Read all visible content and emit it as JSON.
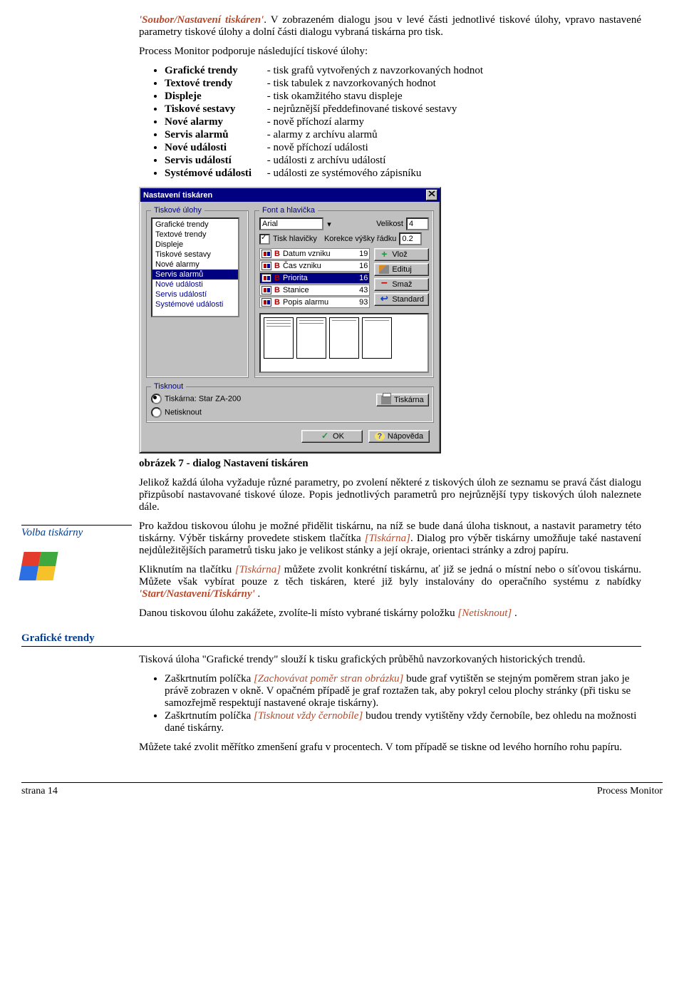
{
  "intro": {
    "menu_path": "'Soubor/Nastavení tiskáren'",
    "sentence_rest": ". V zobrazeném dialogu jsou v levé části jednotlivé tiskové úlohy, vpravo nastavené parametry tiskové úlohy a dolní části dialogu vybraná tiskárna pro tisk.",
    "lead": "Process Monitor podporuje následující tiskové úlohy:"
  },
  "jobs": [
    {
      "term": "Grafické trendy",
      "desc": "- tisk grafů vytvořených z navzorkovaných hodnot"
    },
    {
      "term": "Textové trendy",
      "desc": "- tisk tabulek z navzorkovaných hodnot"
    },
    {
      "term": "Displeje",
      "desc": "- tisk okamžitého stavu displeje"
    },
    {
      "term": "Tiskové sestavy",
      "desc": "- nejrůznější předdefinované tiskové sestavy"
    },
    {
      "term": "Nové alarmy",
      "desc": "- nově příchozí alarmy"
    },
    {
      "term": "Servis alarmů",
      "desc": "- alarmy z archívu alarmů"
    },
    {
      "term": "Nové události",
      "desc": "- nově příchozí události"
    },
    {
      "term": "Servis událostí",
      "desc": "- události z archívu událostí"
    },
    {
      "term": "Systémové události",
      "desc": "- události ze systémového zápisníku"
    }
  ],
  "dialog": {
    "title": "Nastavení tiskáren",
    "group_jobs": "Tiskové úlohy",
    "group_font": "Font a hlavička",
    "jobs_list": [
      {
        "t": "Grafické trendy"
      },
      {
        "t": "Textové trendy"
      },
      {
        "t": "Displeje"
      },
      {
        "t": "Tiskové sestavy"
      },
      {
        "t": "Nové alarmy"
      },
      {
        "t": "Servis alarmů",
        "sel": true
      },
      {
        "t": "Nové události",
        "blue": true
      },
      {
        "t": "Servis událostí",
        "blue": true
      },
      {
        "t": "Systémové události",
        "blue": true
      }
    ],
    "font_value": "Arial",
    "size_label": "Velikost",
    "size_value": "4",
    "head_check": "Tisk hlavičky",
    "corr_label": "Korekce výšky řádku",
    "corr_value": "0.2",
    "columns": [
      {
        "letter": "B",
        "name": "Datum vzniku",
        "val": "19"
      },
      {
        "letter": "B",
        "name": "Čas vzniku",
        "val": "16"
      },
      {
        "letter": "B",
        "name": "Priorita",
        "val": "16",
        "sel": true
      },
      {
        "letter": "B",
        "name": "Stanice",
        "val": "43"
      },
      {
        "letter": "B",
        "name": "Popis alarmu",
        "val": "93"
      }
    ],
    "btn_insert": "Vlož",
    "btn_edit": "Edituj",
    "btn_delete": "Smaž",
    "btn_standard": "Standard",
    "group_print": "Tisknout",
    "radio_printer": "Tiskárna: Star ZA-200",
    "radio_noprint": "Netisknout",
    "btn_printer": "Tiskárna",
    "btn_ok": "OK",
    "btn_help": "Nápověda"
  },
  "fig_caption": "obrázek 7 - dialog Nastavení tiskáren",
  "after_fig": "Jelikož každá úloha vyžaduje různé parametry, po zvolení některé z tiskových úloh ze seznamu se pravá část dialogu přizpůsobí nastavované tiskové úloze. Popis jednotlivých parametrů pro nejrůznější typy tiskových úloh naleznete dále.",
  "volba": {
    "label": "Volba tiskárny",
    "p1_a": "Pro každou tiskovou úlohu je možné přidělit tiskárnu, na níž se bude daná úloha tisknout, a nastavit parametry této tiskárny. Výběr tiskárny provedete stiskem tlačítka ",
    "p1_btn": "[Tiskárna]",
    "p1_b": ". Dialog pro výběr tiskárny umožňuje také nastavení nejdůležitějších parametrů tisku jako je velikost stánky a její okraje, orientaci stránky a zdroj papíru.",
    "p2_a": "Kliknutím na tlačítku ",
    "p2_btn": "[Tiskárna]",
    "p2_b": " můžete zvolit konkrétní tiskárnu, ať již se jedná o místní nebo o síťovou tiskárnu. Můžete však vybírat pouze z těch tiskáren, které již byly instalovány do operačního systému z nabídky ",
    "p2_menu": "'Start/Nastavení/Tiskárny'",
    "p2_c": " .",
    "p3_a": "Danou tiskovou úlohu zakážete, zvolíte-li místo vybrané tiskárny položku ",
    "p3_opt": "[Netisknout]",
    "p3_b": " ."
  },
  "graf": {
    "heading": "Grafické trendy",
    "p1": "Tisková úloha \"Grafické trendy\" slouží k tisku grafických průběhů navzorkovaných historických trendů.",
    "b1_a": "Zaškrtnutím políčka ",
    "b1_opt": "[Zachovávat poměr stran obrázku]",
    "b1_b": " bude graf vytištěn se stejným poměrem stran jako je právě zobrazen v okně. V opačném případě je graf roztažen tak, aby pokryl celou plochy stránky (při tisku se samozřejmě respektují nastavené okraje tiskárny).",
    "b2_a": "Zaškrtnutím políčka ",
    "b2_opt": "[Tisknout vždy černobíle]",
    "b2_b": " budou trendy vytištěny vždy černobíle, bez ohledu na možnosti dané tiskárny.",
    "p2": "Můžete také zvolit měřítko zmenšení grafu v procentech. V tom případě se tiskne od levého horního rohu papíru."
  },
  "footer": {
    "left": "strana 14",
    "right": "Process Monitor"
  }
}
